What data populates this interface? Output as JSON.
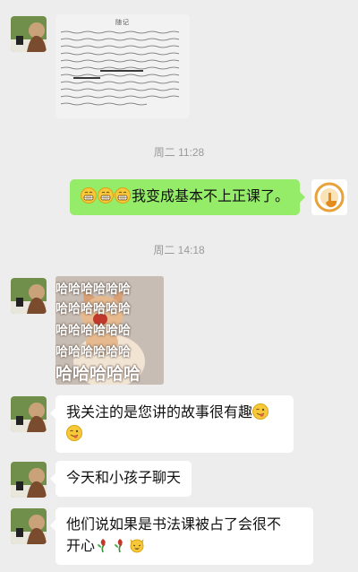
{
  "colors": {
    "background": "#ededed",
    "incoming_bubble": "#ffffff",
    "outgoing_bubble": "#95ec69",
    "timestamp": "#9a9a9a"
  },
  "messages": {
    "photo": {
      "sender": "contact",
      "type": "image",
      "title_text": "随记"
    },
    "time_1": "周二 11:28",
    "outgoing_1": {
      "sender": "me",
      "emoji": [
        "grin-emoji",
        "grin-emoji",
        "grin-emoji"
      ],
      "text": "我变成基本不上正课了。"
    },
    "time_2": "周二 14:18",
    "sticker": {
      "sender": "contact",
      "type": "sticker",
      "text_top": "哈哈哈哈哈哈",
      "text_bottom": "哈哈哈哈哈"
    },
    "incoming_1": {
      "text": "我关注的是您讲的故事很有趣",
      "emoji": [
        "wink-tongue-emoji",
        "wink-tongue-emoji"
      ]
    },
    "incoming_2": {
      "text": "今天和小孩子聊天"
    },
    "incoming_3": {
      "line1": "他们说如果是书法课被占了会很不",
      "line2": "开心",
      "emoji": [
        "wilted-rose-emoji",
        "wilted-rose-emoji",
        "cat-face-emoji"
      ]
    }
  }
}
